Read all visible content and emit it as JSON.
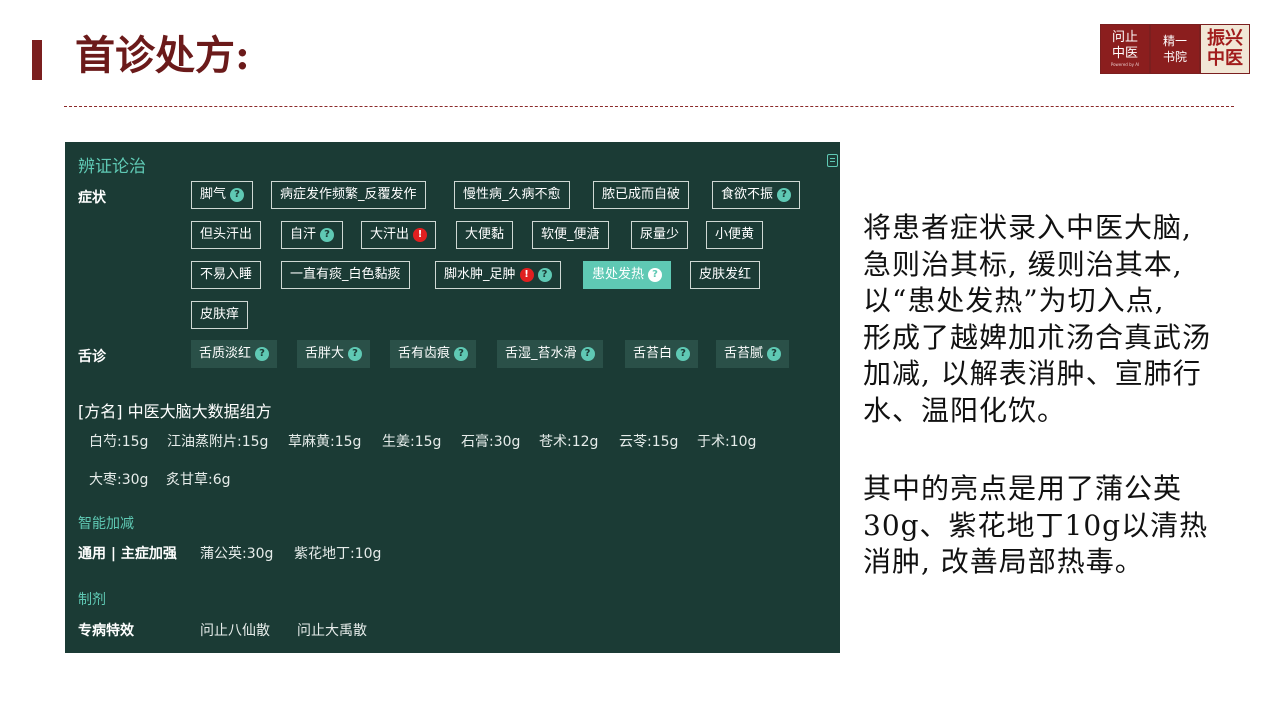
{
  "header": {
    "title": "首诊处方:"
  },
  "logo": {
    "a_line1": "问止",
    "a_line2": "中医",
    "a_sub": "Powered by AI",
    "b_line1": "精一",
    "b_line2": "书院",
    "c_line1": "振兴",
    "c_line2": "中医"
  },
  "panel": {
    "heading": "辨证论治",
    "symptoms_label": "症状",
    "symptoms": [
      {
        "label": "脚气",
        "icon": "?"
      },
      {
        "label": "病症发作频繁_反覆发作"
      },
      {
        "label": "慢性病_久病不愈"
      },
      {
        "label": "脓已成而自破"
      },
      {
        "label": "食欲不振",
        "icon": "?"
      },
      {
        "label": "但头汗出"
      },
      {
        "label": "自汗",
        "icon": "?"
      },
      {
        "label": "大汗出",
        "icon": "!"
      },
      {
        "label": "大便黏"
      },
      {
        "label": "软便_便溏"
      },
      {
        "label": "尿量少"
      },
      {
        "label": "小便黄"
      },
      {
        "label": "不易入睡"
      },
      {
        "label": "一直有痰_白色黏痰"
      },
      {
        "label": "脚水肿_足肿",
        "icon": "!",
        "icon2": "?"
      },
      {
        "label": "患处发热",
        "icon": "?",
        "active": true
      },
      {
        "label": "皮肤发红"
      },
      {
        "label": "皮肤痒"
      }
    ],
    "tongue_label": "舌诊",
    "tongue": [
      {
        "label": "舌质淡红"
      },
      {
        "label": "舌胖大"
      },
      {
        "label": "舌有齿痕"
      },
      {
        "label": "舌湿_苔水滑"
      },
      {
        "label": "舌苔白"
      },
      {
        "label": "舌苔腻"
      }
    ],
    "formula_name": "[方名] 中医大脑大数据组方",
    "herbs": [
      "白芍:15g",
      "江油蒸附片:15g",
      "草麻黄:15g",
      "生姜:15g",
      "石膏:30g",
      "苍术:12g",
      "云苓:15g",
      "于术:10g",
      "大枣:30g",
      "炙甘草:6g"
    ],
    "smart_section": "智能加减",
    "smart_label": "通用 | 主症加强",
    "smart_items": [
      "蒲公英:30g",
      "紫花地丁:10g"
    ],
    "prep_section": "制剂",
    "prep_label": "专病特效",
    "prep_items": [
      "问止八仙散",
      "问止大禹散"
    ]
  },
  "description": {
    "lines1": [
      "将患者症状录入中医大脑,",
      "急则治其标, 缓则治其本,",
      "以“患处发热”为切入点,",
      "形成了越婢加朮汤合真武汤",
      "加减, 以解表消肿、宣肺行",
      "水、温阳化饮。"
    ],
    "lines2": [
      "其中的亮点是用了蒲公英",
      "30g、紫花地丁10g以清热",
      "消肿, 改善局部热毒。"
    ]
  }
}
